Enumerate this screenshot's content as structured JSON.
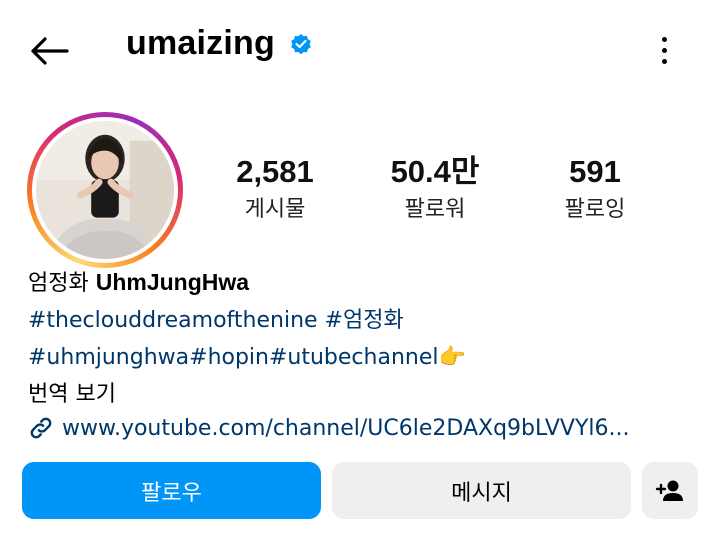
{
  "header": {
    "back_icon": "arrow-left-icon",
    "username": "umaizing",
    "verified_icon": "verified-badge-icon",
    "more_icon": "more-vertical-icon"
  },
  "profile": {
    "avatar_alt": "profile photo",
    "stats": [
      {
        "value": "2,581",
        "label": "게시물"
      },
      {
        "value": "50.4만",
        "label": "팔로워"
      },
      {
        "value": "591",
        "label": "팔로잉"
      }
    ]
  },
  "bio": {
    "name_korean": "엄정화",
    "name_latin": "UhmJungHwa",
    "hashtags_line1": [
      "#theclouddreamofthenine",
      "#엄정화"
    ],
    "hashtags_line2": "#uhmjunghwa#hopin#utubechannel",
    "line2_emoji": "👉",
    "translate": "번역 보기",
    "link_icon": "link-icon",
    "link": "www.youtube.com/channel/UC6le2DAXq9bLVVYl6..."
  },
  "actions": {
    "follow": "팔로우",
    "message": "메시지",
    "add_user_icon": "add-person-icon"
  },
  "colors": {
    "accent": "#0095f6",
    "link": "#00376b",
    "button_gray": "#efefef",
    "verified": "#0095f6"
  }
}
